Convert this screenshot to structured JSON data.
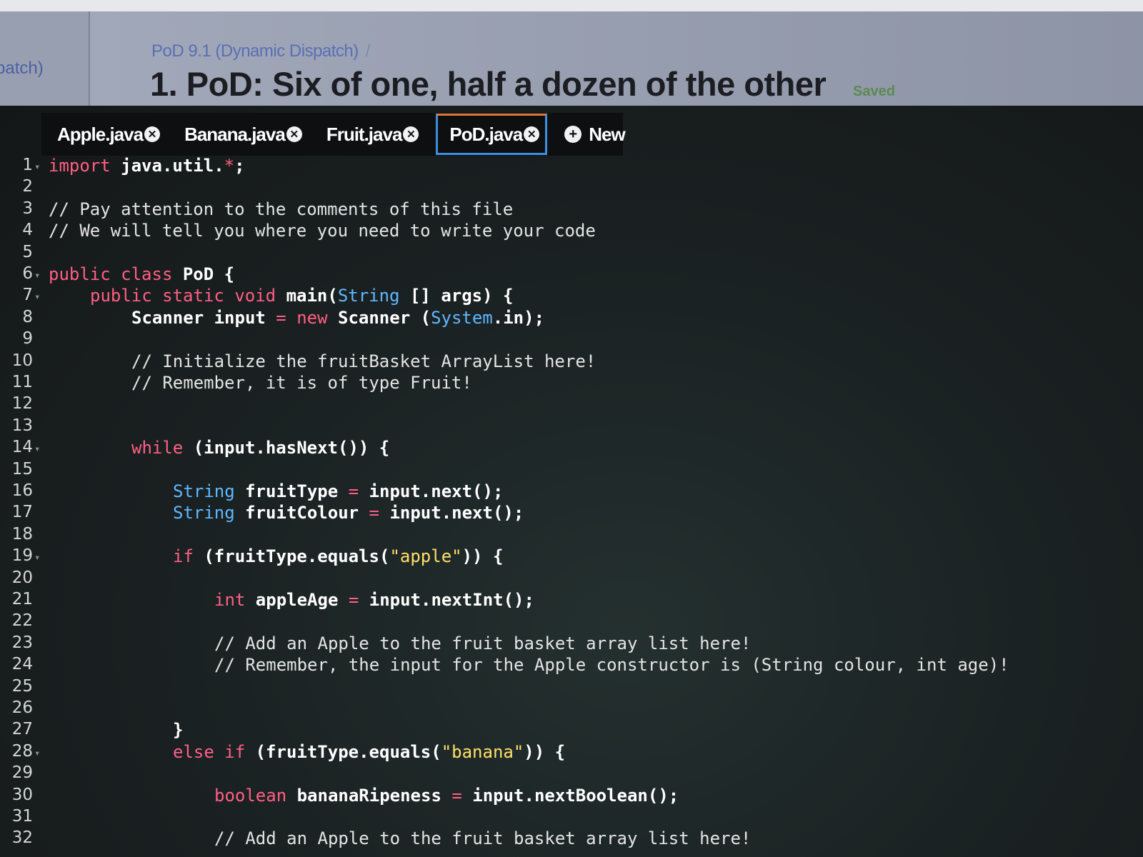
{
  "header": {
    "side_crumb": "patch)",
    "breadcrumb": "PoD 9.1 (Dynamic Dispatch)",
    "breadcrumb_sep": "/",
    "title": "1. PoD: Six of one, half a dozen of the other",
    "status": "Saved"
  },
  "tabs": [
    {
      "label": "Apple.java",
      "active": false
    },
    {
      "label": "Banana.java",
      "active": false
    },
    {
      "label": "Fruit.java",
      "active": false
    },
    {
      "label": "PoD.java",
      "active": true
    }
  ],
  "new_tab_label": "New",
  "colors": {
    "keyword": "#ff5f84",
    "type": "#5fb8ff",
    "string": "#ffe066",
    "comment": "#e4e4e4",
    "active_tab_border": "#3d8fe0",
    "active_tab_top": "#e0783a",
    "saved": "#5c8a50"
  },
  "code_lines": [
    {
      "n": "1",
      "fold": true,
      "indent": 0,
      "tokens": [
        [
          "kw",
          "import"
        ],
        [
          "p",
          " "
        ],
        [
          "b",
          "java.util."
        ],
        [
          "kw",
          "*"
        ],
        [
          "b",
          ";"
        ]
      ]
    },
    {
      "n": "2",
      "fold": false,
      "indent": 0,
      "tokens": []
    },
    {
      "n": "3",
      "fold": false,
      "indent": 0,
      "tokens": [
        [
          "cm",
          "// Pay attention to the comments of this file"
        ]
      ]
    },
    {
      "n": "4",
      "fold": false,
      "indent": 0,
      "tokens": [
        [
          "cm",
          "// We will tell you where you need to write your code"
        ]
      ]
    },
    {
      "n": "5",
      "fold": false,
      "indent": 0,
      "tokens": []
    },
    {
      "n": "6",
      "fold": true,
      "indent": 0,
      "tokens": [
        [
          "kw",
          "public"
        ],
        [
          "p",
          " "
        ],
        [
          "kw",
          "class"
        ],
        [
          "p",
          " "
        ],
        [
          "b",
          "PoD {"
        ]
      ]
    },
    {
      "n": "7",
      "fold": true,
      "indent": 1,
      "tokens": [
        [
          "kw",
          "public"
        ],
        [
          "p",
          " "
        ],
        [
          "kw",
          "static"
        ],
        [
          "p",
          " "
        ],
        [
          "kw",
          "void"
        ],
        [
          "p",
          " "
        ],
        [
          "b",
          "main("
        ],
        [
          "ty",
          "String"
        ],
        [
          "b",
          " [] args) {"
        ]
      ]
    },
    {
      "n": "8",
      "fold": false,
      "indent": 2,
      "tokens": [
        [
          "b",
          "Scanner input "
        ],
        [
          "kw",
          "="
        ],
        [
          "p",
          " "
        ],
        [
          "kw",
          "new"
        ],
        [
          "b",
          " Scanner ("
        ],
        [
          "ty",
          "System"
        ],
        [
          "b",
          ".in);"
        ]
      ]
    },
    {
      "n": "9",
      "fold": false,
      "indent": 0,
      "tokens": []
    },
    {
      "n": "10",
      "fold": false,
      "indent": 2,
      "tokens": [
        [
          "cm",
          "// Initialize the fruitBasket ArrayList here!"
        ]
      ]
    },
    {
      "n": "11",
      "fold": false,
      "indent": 2,
      "tokens": [
        [
          "cm",
          "// Remember, it is of type Fruit!"
        ]
      ]
    },
    {
      "n": "12",
      "fold": false,
      "indent": 0,
      "tokens": []
    },
    {
      "n": "13",
      "fold": false,
      "indent": 0,
      "tokens": []
    },
    {
      "n": "14",
      "fold": true,
      "indent": 2,
      "tokens": [
        [
          "kw",
          "while"
        ],
        [
          "b",
          " (input.hasNext()) {"
        ]
      ]
    },
    {
      "n": "15",
      "fold": false,
      "indent": 0,
      "tokens": []
    },
    {
      "n": "16",
      "fold": false,
      "indent": 3,
      "tokens": [
        [
          "ty",
          "String"
        ],
        [
          "b",
          " fruitType "
        ],
        [
          "kw",
          "="
        ],
        [
          "b",
          " input.next();"
        ]
      ]
    },
    {
      "n": "17",
      "fold": false,
      "indent": 3,
      "tokens": [
        [
          "ty",
          "String"
        ],
        [
          "b",
          " fruitColour "
        ],
        [
          "kw",
          "="
        ],
        [
          "b",
          " input.next();"
        ]
      ]
    },
    {
      "n": "18",
      "fold": false,
      "indent": 0,
      "tokens": []
    },
    {
      "n": "19",
      "fold": true,
      "indent": 3,
      "tokens": [
        [
          "kw",
          "if"
        ],
        [
          "b",
          " (fruitType.equals("
        ],
        [
          "st",
          "\"apple\""
        ],
        [
          "b",
          ")) {"
        ]
      ]
    },
    {
      "n": "20",
      "fold": false,
      "indent": 0,
      "tokens": []
    },
    {
      "n": "21",
      "fold": false,
      "indent": 4,
      "tokens": [
        [
          "kw",
          "int"
        ],
        [
          "b",
          " appleAge "
        ],
        [
          "kw",
          "="
        ],
        [
          "b",
          " input.nextInt();"
        ]
      ]
    },
    {
      "n": "22",
      "fold": false,
      "indent": 0,
      "tokens": []
    },
    {
      "n": "23",
      "fold": false,
      "indent": 4,
      "tokens": [
        [
          "cm",
          "// Add an Apple to the fruit basket array list here!"
        ]
      ]
    },
    {
      "n": "24",
      "fold": false,
      "indent": 4,
      "tokens": [
        [
          "cm",
          "// Remember, the input for the Apple constructor is (String colour, int age)!"
        ]
      ]
    },
    {
      "n": "25",
      "fold": false,
      "indent": 0,
      "tokens": []
    },
    {
      "n": "26",
      "fold": false,
      "indent": 0,
      "tokens": []
    },
    {
      "n": "27",
      "fold": false,
      "indent": 3,
      "tokens": [
        [
          "b",
          "}"
        ]
      ]
    },
    {
      "n": "28",
      "fold": true,
      "indent": 3,
      "tokens": [
        [
          "kw",
          "else"
        ],
        [
          "p",
          " "
        ],
        [
          "kw",
          "if"
        ],
        [
          "b",
          " (fruitType.equals("
        ],
        [
          "st",
          "\"banana\""
        ],
        [
          "b",
          ")) {"
        ]
      ]
    },
    {
      "n": "29",
      "fold": false,
      "indent": 0,
      "tokens": []
    },
    {
      "n": "30",
      "fold": false,
      "indent": 4,
      "tokens": [
        [
          "kw",
          "boolean"
        ],
        [
          "b",
          " bananaRipeness "
        ],
        [
          "kw",
          "="
        ],
        [
          "b",
          " input.nextBoolean();"
        ]
      ]
    },
    {
      "n": "31",
      "fold": false,
      "indent": 0,
      "tokens": []
    },
    {
      "n": "32",
      "fold": false,
      "indent": 4,
      "tokens": [
        [
          "cm",
          "// Add an Apple to the fruit basket array list here!"
        ]
      ]
    }
  ]
}
